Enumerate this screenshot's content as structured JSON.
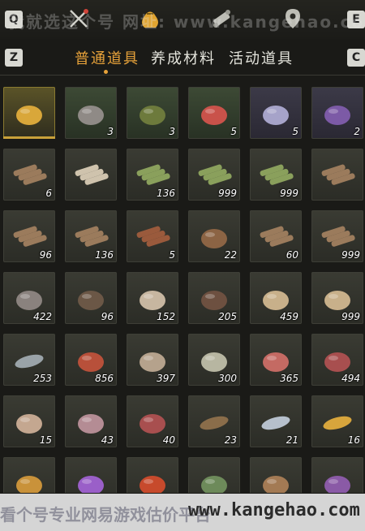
{
  "hotkeys": {
    "q": "Q",
    "e": "E",
    "z": "Z",
    "c": "C"
  },
  "watermark_top": "我就选这个号 网址: www.kangehao.com",
  "tabs": [
    {
      "label": "普通道具",
      "active": true
    },
    {
      "label": "养成材料",
      "active": false
    },
    {
      "label": "活动道具",
      "active": false
    }
  ],
  "inventory": [
    {
      "icon": "golden-toad",
      "count": "",
      "style": "gold"
    },
    {
      "icon": "stone-pinecone",
      "count": "3",
      "style": "green"
    },
    {
      "icon": "cricket",
      "count": "3",
      "style": "green"
    },
    {
      "icon": "firefly",
      "count": "5",
      "style": "green"
    },
    {
      "icon": "dragonfly",
      "count": "5",
      "style": "purple"
    },
    {
      "icon": "purple-flower",
      "count": "2",
      "style": "purple"
    },
    {
      "icon": "logs",
      "count": "6"
    },
    {
      "icon": "birch-logs",
      "count": ""
    },
    {
      "icon": "bamboo-logs",
      "count": "136"
    },
    {
      "icon": "bamboo-logs",
      "count": "999"
    },
    {
      "icon": "bamboo-logs",
      "count": "999"
    },
    {
      "icon": "logs",
      "count": ""
    },
    {
      "icon": "logs",
      "count": "96"
    },
    {
      "icon": "logs",
      "count": "136"
    },
    {
      "icon": "red-logs",
      "count": "5"
    },
    {
      "icon": "hay-bundle",
      "count": "22"
    },
    {
      "icon": "logs",
      "count": "60"
    },
    {
      "icon": "logs",
      "count": "999"
    },
    {
      "icon": "rock",
      "count": "422"
    },
    {
      "icon": "feather",
      "count": "96"
    },
    {
      "icon": "mushrooms",
      "count": "152"
    },
    {
      "icon": "shrimp",
      "count": "205"
    },
    {
      "icon": "grain-sack",
      "count": "459"
    },
    {
      "icon": "grain-sack",
      "count": "999"
    },
    {
      "icon": "fish",
      "count": "253"
    },
    {
      "icon": "berries",
      "count": "856"
    },
    {
      "icon": "mushroom-pile",
      "count": "397"
    },
    {
      "icon": "eggs",
      "count": "300"
    },
    {
      "icon": "raw-meat",
      "count": "365"
    },
    {
      "icon": "steak",
      "count": "494"
    },
    {
      "icon": "hide",
      "count": "15"
    },
    {
      "icon": "intestine",
      "count": "43"
    },
    {
      "icon": "steak",
      "count": "40"
    },
    {
      "icon": "eel",
      "count": "23"
    },
    {
      "icon": "tuna",
      "count": "21"
    },
    {
      "icon": "golden-carp",
      "count": "16"
    },
    {
      "icon": "golden-nugget",
      "count": ""
    },
    {
      "icon": "amethyst",
      "count": ""
    },
    {
      "icon": "red-orb",
      "count": ""
    },
    {
      "icon": "herb",
      "count": ""
    },
    {
      "icon": "mortar-bowl",
      "count": ""
    },
    {
      "icon": "purple-herb",
      "count": ""
    }
  ],
  "footer_watermark": "看个号专业网易游戏估价平台",
  "footer_url": "www.kangehao.com"
}
